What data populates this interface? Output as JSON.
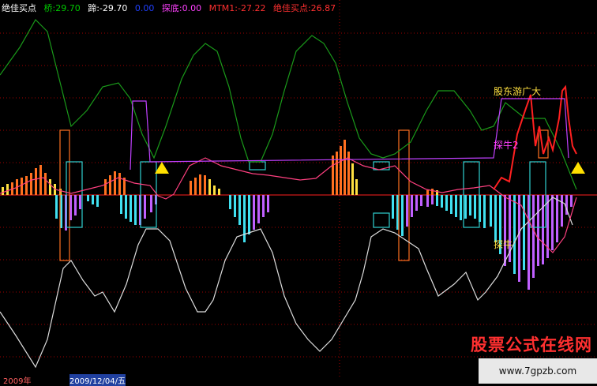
{
  "header": {
    "title": "绝佳买点",
    "items": [
      {
        "label": "桥:29.70",
        "color": "#00c800"
      },
      {
        "label": "蹄:-29.70",
        "color": "#ffffff"
      },
      {
        "label": "0.00",
        "color": "#2040ff"
      },
      {
        "label": "探底:0.00",
        "color": "#ff40ff"
      },
      {
        "label": "MTM1:-27.22",
        "color": "#ff3030"
      },
      {
        "label": "绝佳买点:26.87",
        "color": "#ff3030"
      }
    ]
  },
  "annotations": [
    "股东游广大",
    "探牛2",
    "探牛"
  ],
  "bottom_labels": [
    "2009年",
    "2009/12/04/五"
  ],
  "watermark": {
    "text": "股票公式在线网",
    "url": "www.7gpzb.com"
  },
  "colors": {
    "background": "#000000",
    "grid": "#a00000",
    "green": "#1a9a1a",
    "white": "#dddddd",
    "pink": "#ff4080",
    "cyan": "#40e0f0",
    "violet": "#c060ff",
    "orange": "#ff7020",
    "yellow": "#ffe040",
    "frame": "#30d0d0",
    "magenta": "#c040ff",
    "red": "#ff2020"
  },
  "chart_data": {
    "type": "line",
    "grid": true,
    "series": [
      {
        "name": "green_osc",
        "color": "#1a9a1a",
        "points": [
          [
            0,
            95
          ],
          [
            25,
            60
          ],
          [
            45,
            25
          ],
          [
            60,
            40
          ],
          [
            75,
            100
          ],
          [
            90,
            160
          ],
          [
            110,
            140
          ],
          [
            130,
            110
          ],
          [
            150,
            105
          ],
          [
            165,
            125
          ],
          [
            180,
            170
          ],
          [
            195,
            200
          ],
          [
            210,
            160
          ],
          [
            230,
            100
          ],
          [
            245,
            70
          ],
          [
            260,
            55
          ],
          [
            275,
            65
          ],
          [
            290,
            110
          ],
          [
            305,
            175
          ],
          [
            315,
            205
          ],
          [
            330,
            205
          ],
          [
            345,
            170
          ],
          [
            360,
            115
          ],
          [
            375,
            65
          ],
          [
            395,
            45
          ],
          [
            410,
            55
          ],
          [
            425,
            80
          ],
          [
            440,
            130
          ],
          [
            455,
            175
          ],
          [
            470,
            195
          ],
          [
            485,
            200
          ],
          [
            500,
            195
          ],
          [
            520,
            180
          ],
          [
            540,
            140
          ],
          [
            555,
            115
          ],
          [
            575,
            115
          ],
          [
            595,
            140
          ],
          [
            610,
            165
          ],
          [
            625,
            160
          ],
          [
            640,
            130
          ],
          [
            665,
            150
          ],
          [
            690,
            150
          ],
          [
            710,
            190
          ],
          [
            730,
            240
          ]
        ]
      },
      {
        "name": "white_osc",
        "color": "#dddddd",
        "points": [
          [
            0,
            395
          ],
          [
            20,
            425
          ],
          [
            45,
            465
          ],
          [
            60,
            430
          ],
          [
            80,
            340
          ],
          [
            90,
            330
          ],
          [
            105,
            355
          ],
          [
            120,
            375
          ],
          [
            130,
            370
          ],
          [
            145,
            395
          ],
          [
            160,
            360
          ],
          [
            175,
            310
          ],
          [
            185,
            290
          ],
          [
            200,
            290
          ],
          [
            215,
            305
          ],
          [
            235,
            365
          ],
          [
            250,
            395
          ],
          [
            260,
            395
          ],
          [
            270,
            380
          ],
          [
            285,
            330
          ],
          [
            300,
            300
          ],
          [
            315,
            295
          ],
          [
            330,
            290
          ],
          [
            345,
            320
          ],
          [
            360,
            375
          ],
          [
            375,
            410
          ],
          [
            390,
            430
          ],
          [
            405,
            445
          ],
          [
            420,
            430
          ],
          [
            435,
            405
          ],
          [
            450,
            380
          ],
          [
            460,
            345
          ],
          [
            470,
            300
          ],
          [
            485,
            290
          ],
          [
            500,
            295
          ],
          [
            515,
            305
          ],
          [
            530,
            315
          ],
          [
            540,
            340
          ],
          [
            555,
            375
          ],
          [
            575,
            360
          ],
          [
            590,
            345
          ],
          [
            605,
            380
          ],
          [
            615,
            370
          ],
          [
            630,
            350
          ],
          [
            645,
            320
          ],
          [
            660,
            290
          ],
          [
            680,
            270
          ],
          [
            700,
            250
          ],
          [
            715,
            258
          ],
          [
            725,
            285
          ]
        ]
      },
      {
        "name": "pink_osc",
        "color": "#ff4080",
        "points": [
          [
            0,
            245
          ],
          [
            20,
            238
          ],
          [
            40,
            228
          ],
          [
            55,
            225
          ],
          [
            70,
            240
          ],
          [
            90,
            245
          ],
          [
            110,
            240
          ],
          [
            130,
            235
          ],
          [
            150,
            225
          ],
          [
            170,
            232
          ],
          [
            190,
            235
          ],
          [
            200,
            248
          ],
          [
            210,
            252
          ],
          [
            220,
            246
          ],
          [
            240,
            210
          ],
          [
            260,
            200
          ],
          [
            280,
            210
          ],
          [
            300,
            215
          ],
          [
            320,
            220
          ],
          [
            340,
            222
          ],
          [
            360,
            225
          ],
          [
            380,
            228
          ],
          [
            400,
            226
          ],
          [
            420,
            210
          ],
          [
            440,
            200
          ],
          [
            460,
            210
          ],
          [
            480,
            215
          ],
          [
            500,
            210
          ],
          [
            520,
            230
          ],
          [
            540,
            240
          ],
          [
            560,
            244
          ],
          [
            580,
            240
          ],
          [
            600,
            238
          ],
          [
            620,
            235
          ],
          [
            640,
            250
          ],
          [
            660,
            260
          ],
          [
            680,
            300
          ],
          [
            700,
            320
          ],
          [
            715,
            300
          ],
          [
            730,
            250
          ]
        ]
      },
      {
        "name": "red_line",
        "color": "#ff2020",
        "points": [
          [
            625,
            240
          ],
          [
            635,
            225
          ],
          [
            645,
            230
          ],
          [
            655,
            170
          ],
          [
            665,
            140
          ],
          [
            672,
            120
          ],
          [
            678,
            185
          ],
          [
            683,
            160
          ],
          [
            688,
            195
          ],
          [
            695,
            175
          ],
          [
            700,
            190
          ],
          [
            708,
            150
          ],
          [
            712,
            115
          ],
          [
            716,
            110
          ],
          [
            720,
            150
          ],
          [
            725,
            185
          ],
          [
            730,
            195
          ]
        ]
      },
      {
        "name": "magenta_line",
        "color": "#c040ff",
        "points": [
          [
            165,
            215
          ],
          [
            168,
            128
          ],
          [
            185,
            128
          ],
          [
            190,
            205
          ],
          [
            625,
            200
          ],
          [
            635,
            125
          ],
          [
            715,
            125
          ],
          [
            720,
            200
          ]
        ]
      }
    ],
    "bars_up": [
      {
        "x": [
          2,
          8,
          14,
          20,
          26,
          32,
          38,
          44,
          50,
          56,
          62,
          68,
          75
        ],
        "h": [
          10,
          14,
          16,
          20,
          22,
          24,
          28,
          34,
          38,
          28,
          20,
          14,
          8
        ],
        "colors": [
          "#ffe040",
          "#ffe040",
          "#ff7020",
          "#ff7020",
          "#ff7020",
          "#ff7020",
          "#ff7020",
          "#ff7020",
          "#ff7020",
          "#ff7020",
          "#ffe040",
          "#ffe040",
          "#ffe040"
        ]
      },
      {
        "x": [
          132,
          138,
          144,
          150,
          156
        ],
        "h": [
          20,
          25,
          30,
          28,
          22
        ],
        "colors": [
          "#ff7020",
          "#ff7020",
          "#ff7020",
          "#ff7020",
          "#ff7020"
        ]
      },
      {
        "x": [
          240,
          246,
          252,
          258,
          264,
          270,
          276
        ],
        "h": [
          18,
          22,
          26,
          25,
          20,
          12,
          8
        ],
        "colors": [
          "#ff7020",
          "#ff7020",
          "#ff7020",
          "#ff7020",
          "#ffe040",
          "#ffe040",
          "#ffe040"
        ]
      },
      {
        "x": [
          420,
          425,
          430,
          435,
          440,
          445,
          450
        ],
        "h": [
          50,
          55,
          62,
          70,
          55,
          40,
          20
        ],
        "colors": [
          "#ff7020",
          "#ff7020",
          "#ff7020",
          "#ff7020",
          "#ff7020",
          "#ffe040",
          "#ffe040"
        ]
      },
      {
        "x": [
          540,
          546,
          552
        ],
        "h": [
          6,
          8,
          6
        ],
        "colors": [
          "#ff7020",
          "#ff7020",
          "#ffe040"
        ]
      }
    ],
    "bars_down": [
      {
        "x": [
          70,
          76,
          82,
          88,
          94,
          100,
          110,
          116,
          122
        ],
        "h": [
          30,
          42,
          45,
          32,
          26,
          18,
          8,
          12,
          15
        ],
        "colors": [
          "#40e0f0",
          "#40e0f0",
          "#c060ff",
          "#c060ff",
          "#c060ff",
          "#c060ff",
          "#40e0f0",
          "#40e0f0",
          "#40e0f0"
        ]
      },
      {
        "x": [
          152,
          158,
          164,
          170,
          176,
          182,
          190,
          196
        ],
        "h": [
          24,
          30,
          34,
          38,
          38,
          30,
          22,
          12
        ],
        "colors": [
          "#40e0f0",
          "#40e0f0",
          "#40e0f0",
          "#40e0f0",
          "#c060ff",
          "#c060ff",
          "#c060ff",
          "#c060ff"
        ]
      },
      {
        "x": [
          290,
          296,
          302,
          308,
          314,
          320,
          326,
          332,
          338
        ],
        "h": [
          18,
          28,
          38,
          60,
          50,
          44,
          36,
          28,
          22
        ],
        "colors": [
          "#40e0f0",
          "#40e0f0",
          "#40e0f0",
          "#40e0f0",
          "#40e0f0",
          "#c060ff",
          "#c060ff",
          "#c060ff",
          "#c060ff"
        ]
      },
      {
        "x": [
          496,
          502,
          508,
          514,
          520,
          526,
          532
        ],
        "h": [
          30,
          44,
          52,
          40,
          28,
          20,
          14
        ],
        "colors": [
          "#40e0f0",
          "#40e0f0",
          "#40e0f0",
          "#c060ff",
          "#c060ff",
          "#c060ff",
          "#c060ff"
        ]
      },
      {
        "x": [
          540,
          546,
          552,
          558,
          564,
          570,
          576,
          582,
          588,
          594,
          600,
          606,
          612
        ],
        "h": [
          15,
          12,
          14,
          16,
          20,
          24,
          28,
          32,
          30,
          26,
          30,
          34,
          42
        ],
        "colors": [
          "#c060ff",
          "#c060ff",
          "#40e0f0",
          "#40e0f0",
          "#40e0f0",
          "#40e0f0",
          "#40e0f0",
          "#40e0f0",
          "#40e0f0",
          "#40e0f0",
          "#40e0f0",
          "#40e0f0",
          "#40e0f0"
        ]
      },
      {
        "x": [
          620,
          626,
          632,
          638,
          644,
          650,
          656,
          662,
          668,
          674,
          680,
          686,
          692,
          698,
          704,
          710,
          716,
          722
        ],
        "h": [
          40,
          60,
          75,
          90,
          85,
          100,
          110,
          95,
          120,
          105,
          90,
          88,
          80,
          70,
          60,
          40,
          25,
          15
        ],
        "colors": [
          "#40e0f0",
          "#40e0f0",
          "#40e0f0",
          "#c060ff",
          "#c060ff",
          "#40e0f0",
          "#c060ff",
          "#40e0f0",
          "#c060ff",
          "#c060ff",
          "#c060ff",
          "#c060ff",
          "#c060ff",
          "#c060ff",
          "#c060ff",
          "#c060ff",
          "#c060ff",
          "#c060ff"
        ]
      }
    ],
    "boxes": [
      {
        "x0": 76,
        "x1": 88,
        "y0": 165,
        "y1": 330,
        "color": "#ff7020"
      },
      {
        "x0": 84,
        "x1": 104,
        "y0": 205,
        "y1": 288,
        "color": "#30d0d0"
      },
      {
        "x0": 178,
        "x1": 198,
        "y0": 205,
        "y1": 288,
        "color": "#30d0d0"
      },
      {
        "x0": 316,
        "x1": 336,
        "y0": 205,
        "y1": 215,
        "color": "#30d0d0"
      },
      {
        "x0": 473,
        "x1": 493,
        "y0": 205,
        "y1": 215,
        "color": "#30d0d0"
      },
      {
        "x0": 505,
        "x1": 518,
        "y0": 165,
        "y1": 330,
        "color": "#ff7020"
      },
      {
        "x0": 473,
        "x1": 493,
        "y0": 270,
        "y1": 288,
        "color": "#30d0d0"
      },
      {
        "x0": 587,
        "x1": 607,
        "y0": 205,
        "y1": 288,
        "color": "#30d0d0"
      },
      {
        "x0": 671,
        "x1": 691,
        "y0": 205,
        "y1": 288,
        "color": "#30d0d0"
      },
      {
        "x0": 682,
        "x1": 694,
        "y0": 165,
        "y1": 200,
        "color": "#ff7020"
      }
    ],
    "markers": [
      {
        "x": 205,
        "y": 215,
        "color": "#ffe000"
      },
      {
        "x": 732,
        "y": 215,
        "color": "#ffe000"
      }
    ]
  }
}
